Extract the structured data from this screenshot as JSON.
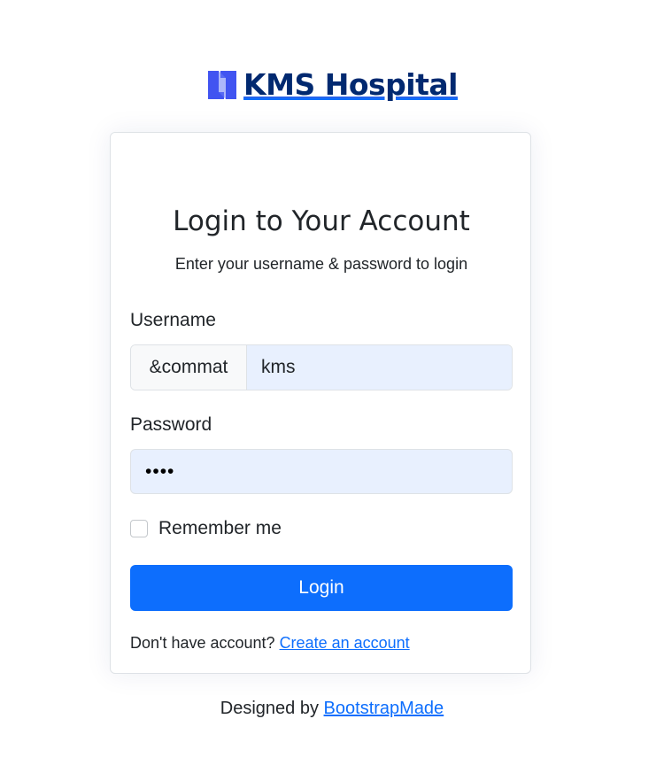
{
  "header": {
    "logo_icon": "hospital-logo-icon",
    "brand_name": "KMS Hospital",
    "brand_color": "#012970",
    "logo_accent": "#4154f1"
  },
  "login": {
    "title": "Login to Your Account",
    "subtitle": "Enter your username & password to login",
    "username_label": "Username",
    "username_prefix": "&commat",
    "username_value": "kms",
    "password_label": "Password",
    "password_value": "••••",
    "remember_label": "Remember me",
    "remember_checked": false,
    "submit_label": "Login",
    "signup_prompt": "Don't have account?",
    "signup_link": "Create an account",
    "button_color": "#0d6efd"
  },
  "footer": {
    "credits_prefix": "Designed by",
    "credits_link": "BootstrapMade"
  }
}
